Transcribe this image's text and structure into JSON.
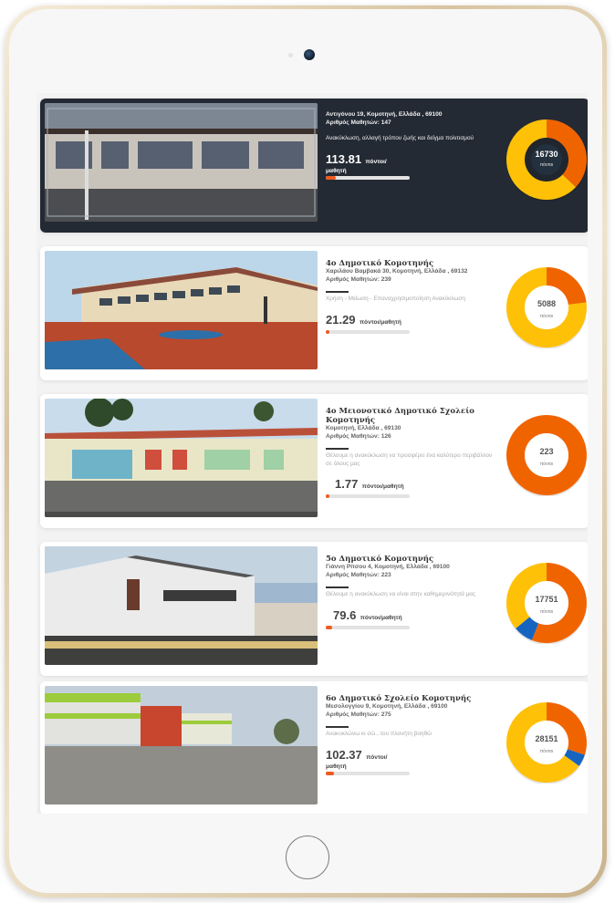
{
  "schools": [
    {
      "name": "",
      "address": "Αντιγόνου 19, Κομοτηνή, Ελλάδα , 69100",
      "students": "Αριθμός Μαθητών: 147",
      "motto": "Ανακύκλωση, αλλαγή τρόπου ζωής και δείγμα πολιτισμού",
      "score": "113.81",
      "score_unit": "πόντοι/",
      "score_unit2": "μαθητή",
      "progress": 0.12,
      "total_points": "16730",
      "points_unit": "πόντοι",
      "donut": [
        {
          "value": 0.37,
          "color": "#f06400"
        },
        {
          "value": 0.63,
          "color": "#ffc107"
        }
      ],
      "theme": "dark"
    },
    {
      "name": "4ο Δημοτικό Κομοτηνής",
      "address": "Χαριλάου Βαμβακά 30, Κομοτηνή, Ελλάδα , 69132",
      "students": "Αριθμός Μαθητών: 239",
      "motto": "Χρήση - Μείωση - Επαναχρησιμοποίηση Ανακύκλωση",
      "score": "21.29",
      "score_unit": "πόντοι/μαθητή",
      "progress": 0.02,
      "total_points": "5088",
      "points_unit": "πόντοι",
      "donut": [
        {
          "value": 0.23,
          "color": "#f06400"
        },
        {
          "value": 0.77,
          "color": "#ffc107"
        }
      ],
      "theme": "light"
    },
    {
      "name": "4ο Μειονοτικό Δημοτικό Σχολείο Κομοτηνής",
      "address": "Κομοτηνή, Ελλάδα , 69130",
      "students": "Αριθμός Μαθητών: 126",
      "motto": "Θέλουμε η ανακύκλωση να προσφέρει ένα καλύτερο περιβάλλον σε όλους μας",
      "score": "1.77",
      "score_unit": "πόντοι/μαθητή",
      "progress": 0.01,
      "total_points": "223",
      "points_unit": "πόντοι",
      "donut": [
        {
          "value": 1.0,
          "color": "#f06400"
        }
      ],
      "theme": "light"
    },
    {
      "name": "5ο Δημοτικό Κομοτηνής",
      "address": "Γιάννη Ρίτσου 4, Κομοτηνή, Ελλάδα , 69100",
      "students": "Αριθμός Μαθητών: 223",
      "motto": "Θέλουμε η ανακύκλωση να είναι στην καθημερινότητά μας",
      "score": "79.6",
      "score_unit": "πόντοι/μαθητή",
      "progress": 0.08,
      "total_points": "17751",
      "points_unit": "πόντοι",
      "donut": [
        {
          "value": 0.56,
          "color": "#f06400"
        },
        {
          "value": 0.08,
          "color": "#1565c0"
        },
        {
          "value": 0.36,
          "color": "#ffc107"
        }
      ],
      "theme": "light"
    },
    {
      "name": "6ο Δημοτικό Σχολείο Κομοτηνής",
      "address": "Μεσολογγίου 9, Κομοτηνή, Ελλάδα , 69100",
      "students": "Αριθμός Μαθητών: 275",
      "motto": "Ανακυκλώνω κι σώ...του πλανήτη βοηθώ",
      "score": "102.37",
      "score_unit": "πόντοι/",
      "score_unit2": "μαθητή",
      "progress": 0.1,
      "total_points": "28151",
      "points_unit": "πόντοι",
      "donut": [
        {
          "value": 0.3,
          "color": "#f06400"
        },
        {
          "value": 0.05,
          "color": "#1565c0"
        },
        {
          "value": 0.65,
          "color": "#ffc107"
        }
      ],
      "theme": "light"
    }
  ]
}
